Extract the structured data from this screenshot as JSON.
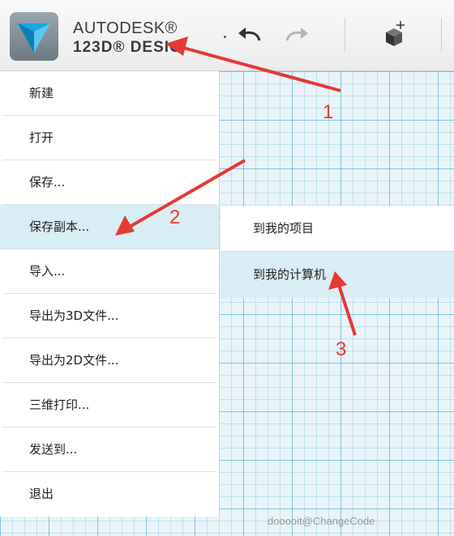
{
  "header": {
    "brand_line1": "AUTODESK®",
    "brand_line2": "123D® DESIG",
    "icons": [
      "app-logo-icon",
      "undo-icon",
      "redo-icon",
      "transform-cube-icon"
    ]
  },
  "menu": {
    "items": [
      {
        "label": "新建"
      },
      {
        "label": "打开"
      },
      {
        "label": "保存..."
      },
      {
        "label": "保存副本..."
      },
      {
        "label": "导入..."
      },
      {
        "label": "导出为3D文件..."
      },
      {
        "label": "导出为2D文件..."
      },
      {
        "label": "三维打印..."
      },
      {
        "label": "发送到..."
      },
      {
        "label": "退出"
      }
    ],
    "active_index": 3
  },
  "submenu": {
    "items": [
      {
        "label": "到我的项目"
      },
      {
        "label": "到我的计算机"
      }
    ]
  },
  "annotations": {
    "labels": [
      "1",
      "2",
      "3"
    ],
    "color": "#e53935"
  },
  "watermark": "dooooit@ChangeCode"
}
